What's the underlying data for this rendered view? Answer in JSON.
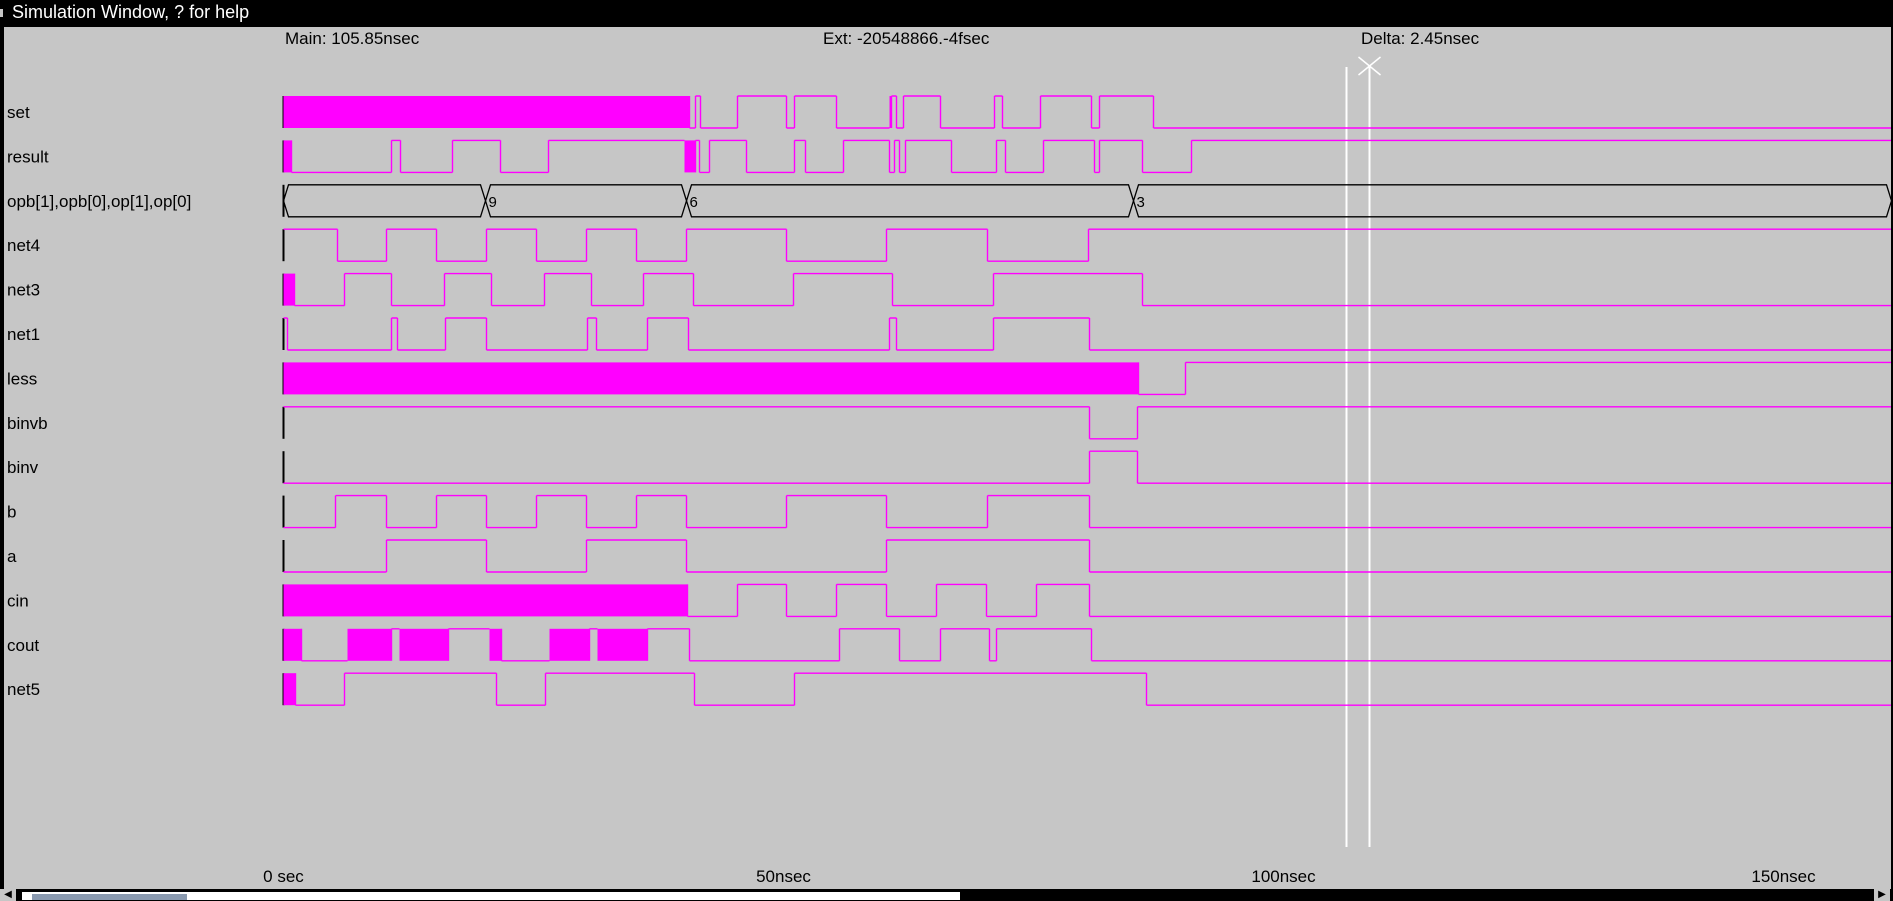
{
  "window": {
    "title": "Simulation Window, ? for help"
  },
  "header": {
    "main": "Main: 105.85nsec",
    "ext": "Ext: -20548866.-4fsec",
    "delta": "Delta: 2.45nsec"
  },
  "time_axis": {
    "ticks": [
      {
        "t": 0,
        "label": "0 sec"
      },
      {
        "t": 50,
        "label": "50nsec"
      },
      {
        "t": 100,
        "label": "100nsec"
      },
      {
        "t": 150,
        "label": "150nsec"
      }
    ]
  },
  "cursors": {
    "main_ns": 106.3,
    "ext_ns": 108.6
  },
  "colors": {
    "background": "#c6c6c6",
    "trace": "#ff00ff",
    "bus": "#000000",
    "cursor": "#ffffff",
    "text": "#000000"
  },
  "signals": [
    {
      "name": "set",
      "kind": "bit",
      "edges": [
        [
          0,
          "x"
        ],
        [
          40.6,
          0
        ],
        [
          41.2,
          1
        ],
        [
          41.7,
          0
        ],
        [
          45.4,
          1
        ],
        [
          50.3,
          0
        ],
        [
          51.1,
          1
        ],
        [
          55.3,
          0
        ],
        [
          60.6,
          "x"
        ],
        [
          60.8,
          1
        ],
        [
          61.3,
          0
        ],
        [
          62.0,
          1
        ],
        [
          65.7,
          0
        ],
        [
          71.1,
          1
        ],
        [
          71.9,
          0
        ],
        [
          75.7,
          1
        ],
        [
          80.8,
          0
        ],
        [
          81.6,
          1
        ],
        [
          87.0,
          0
        ]
      ]
    },
    {
      "name": "result",
      "kind": "bit",
      "edges": [
        [
          0,
          "x"
        ],
        [
          0.8,
          0
        ],
        [
          10.8,
          1
        ],
        [
          11.7,
          0
        ],
        [
          16.9,
          1
        ],
        [
          21.7,
          0
        ],
        [
          26.5,
          1
        ],
        [
          40.1,
          "x"
        ],
        [
          41.2,
          1
        ],
        [
          41.6,
          0
        ],
        [
          42.6,
          1
        ],
        [
          46.3,
          0
        ],
        [
          51.1,
          1
        ],
        [
          52.2,
          0
        ],
        [
          56.0,
          1
        ],
        [
          60.6,
          0
        ],
        [
          61.1,
          1
        ],
        [
          61.6,
          0
        ],
        [
          62.2,
          1
        ],
        [
          66.8,
          0
        ],
        [
          71.3,
          1
        ],
        [
          72.2,
          0
        ],
        [
          76.0,
          1
        ],
        [
          81.1,
          0
        ],
        [
          81.6,
          1
        ],
        [
          85.9,
          0
        ],
        [
          90.8,
          1
        ]
      ]
    },
    {
      "name": "opb[1],opb[0],op[1],op[0]",
      "kind": "bus",
      "segments": [
        {
          "start": 0,
          "end": 20.2,
          "label": ""
        },
        {
          "start": 20.2,
          "end": 40.3,
          "label": "9"
        },
        {
          "start": 40.3,
          "end": 85.0,
          "label": "6"
        },
        {
          "start": 85.0,
          "end": 160.8,
          "label": "3"
        }
      ]
    },
    {
      "name": "net4",
      "kind": "bit",
      "edges": [
        [
          0,
          1
        ],
        [
          5.4,
          0
        ],
        [
          10.3,
          1
        ],
        [
          15.3,
          0
        ],
        [
          20.3,
          1
        ],
        [
          25.3,
          0
        ],
        [
          30.3,
          1
        ],
        [
          35.3,
          0
        ],
        [
          40.3,
          1
        ],
        [
          50.3,
          0
        ],
        [
          60.3,
          1
        ],
        [
          70.4,
          0
        ],
        [
          80.5,
          1
        ]
      ]
    },
    {
      "name": "net3",
      "kind": "bit",
      "edges": [
        [
          0,
          "x"
        ],
        [
          1.1,
          0
        ],
        [
          6.1,
          1
        ],
        [
          10.8,
          0
        ],
        [
          16.1,
          1
        ],
        [
          20.8,
          0
        ],
        [
          26.1,
          1
        ],
        [
          30.8,
          0
        ],
        [
          36.0,
          1
        ],
        [
          41.0,
          0
        ],
        [
          51.0,
          1
        ],
        [
          60.9,
          0
        ],
        [
          71.0,
          1
        ],
        [
          85.9,
          0
        ]
      ]
    },
    {
      "name": "net1",
      "kind": "bit",
      "edges": [
        [
          0,
          1
        ],
        [
          0.4,
          0
        ],
        [
          10.8,
          1
        ],
        [
          11.4,
          0
        ],
        [
          16.2,
          1
        ],
        [
          20.3,
          0
        ],
        [
          30.4,
          1
        ],
        [
          31.3,
          0
        ],
        [
          36.4,
          1
        ],
        [
          40.5,
          0
        ],
        [
          60.6,
          1
        ],
        [
          61.3,
          0
        ],
        [
          71.0,
          1
        ],
        [
          80.6,
          0
        ]
      ]
    },
    {
      "name": "less",
      "kind": "bit",
      "edges": [
        [
          0,
          "x"
        ],
        [
          85.5,
          0
        ],
        [
          90.2,
          1
        ]
      ]
    },
    {
      "name": "binvb",
      "kind": "bit",
      "edges": [
        [
          0,
          1
        ],
        [
          80.6,
          0
        ],
        [
          85.4,
          1
        ]
      ]
    },
    {
      "name": "binv",
      "kind": "bit",
      "edges": [
        [
          0,
          0
        ],
        [
          80.6,
          1
        ],
        [
          85.4,
          0
        ]
      ]
    },
    {
      "name": "b",
      "kind": "bit",
      "edges": [
        [
          0,
          0
        ],
        [
          5.2,
          1
        ],
        [
          10.3,
          0
        ],
        [
          15.3,
          1
        ],
        [
          20.3,
          0
        ],
        [
          25.3,
          1
        ],
        [
          30.3,
          0
        ],
        [
          35.3,
          1
        ],
        [
          40.3,
          0
        ],
        [
          50.3,
          1
        ],
        [
          60.3,
          0
        ],
        [
          70.4,
          1
        ],
        [
          80.6,
          0
        ]
      ]
    },
    {
      "name": "a",
      "kind": "bit",
      "edges": [
        [
          0,
          0
        ],
        [
          10.3,
          1
        ],
        [
          20.3,
          0
        ],
        [
          30.3,
          1
        ],
        [
          40.3,
          0
        ],
        [
          60.3,
          1
        ],
        [
          80.6,
          0
        ]
      ]
    },
    {
      "name": "cin",
      "kind": "bit",
      "edges": [
        [
          0,
          "x"
        ],
        [
          40.4,
          0
        ],
        [
          45.4,
          1
        ],
        [
          50.3,
          0
        ],
        [
          55.3,
          1
        ],
        [
          60.3,
          0
        ],
        [
          65.3,
          1
        ],
        [
          70.3,
          0
        ],
        [
          75.3,
          1
        ],
        [
          80.6,
          0
        ]
      ]
    },
    {
      "name": "cout",
      "kind": "bit",
      "edges": [
        [
          0,
          "x"
        ],
        [
          1.8,
          0
        ],
        [
          6.4,
          "x"
        ],
        [
          10.8,
          1
        ],
        [
          11.6,
          "x"
        ],
        [
          16.5,
          1
        ],
        [
          20.6,
          "x"
        ],
        [
          21.8,
          0
        ],
        [
          26.6,
          "x"
        ],
        [
          30.6,
          1
        ],
        [
          31.4,
          "x"
        ],
        [
          36.4,
          1
        ],
        [
          40.6,
          0
        ],
        [
          55.6,
          1
        ],
        [
          61.6,
          0
        ],
        [
          65.7,
          1
        ],
        [
          70.6,
          0
        ],
        [
          71.3,
          1
        ],
        [
          80.8,
          0
        ]
      ]
    },
    {
      "name": "net5",
      "kind": "bit",
      "edges": [
        [
          0,
          "x"
        ],
        [
          1.2,
          0
        ],
        [
          6.1,
          1
        ],
        [
          21.3,
          0
        ],
        [
          26.2,
          1
        ],
        [
          41.1,
          0
        ],
        [
          51.1,
          1
        ],
        [
          86.3,
          0
        ]
      ]
    }
  ]
}
